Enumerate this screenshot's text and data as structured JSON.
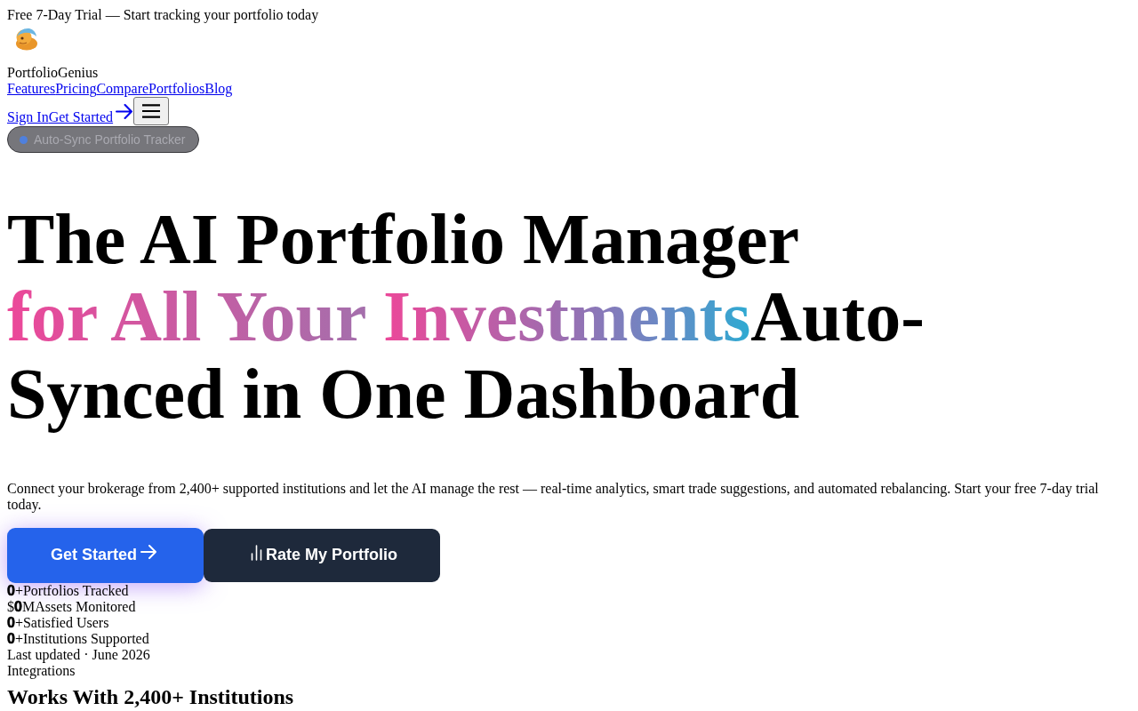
{
  "promo_bar": {
    "text": "Free 7-Day Trial — Start tracking your portfolio today"
  },
  "brand": {
    "name": "PortfolioGenius"
  },
  "nav": {
    "links": [
      "Features",
      "Pricing",
      "Compare",
      "Portfolios",
      "Blog"
    ]
  },
  "actions": {
    "sign_in": "Sign In",
    "get_started": "Get Started"
  },
  "badge": {
    "text": "Auto-Sync Portfolio Tracker"
  },
  "hero": {
    "heading": [
      {
        "kind": "line",
        "text": "The AI Portfolio Manager"
      },
      {
        "kind": "gradient",
        "text": "for All Your "
      },
      {
        "kind": "gradient",
        "text": "Investments"
      },
      {
        "kind": "plain",
        "text": "Auto-Synced in One Dashboard"
      }
    ],
    "subtitle": "Connect your brokerage from 2,400+ supported institutions and let the AI manage the rest — real-time analytics, smart trade suggestions, and automated rebalancing. Start your free 7-day trial today.",
    "buttons": [
      {
        "kind": "primary",
        "label": "Get Started"
      },
      {
        "kind": "secondary",
        "label": "Rate My Portfolio"
      }
    ],
    "stats": [
      "**0**+Portfolios Tracked",
      "$**0**MAssets Monitored",
      "**0**+Satisfied Users",
      "**0**+Institutions Supported"
    ],
    "last_updated": "Last updated · June 2026"
  },
  "integrations": {
    "eyebrow": "Integrations",
    "heading": "Works With 2,400+ Institutions"
  }
}
